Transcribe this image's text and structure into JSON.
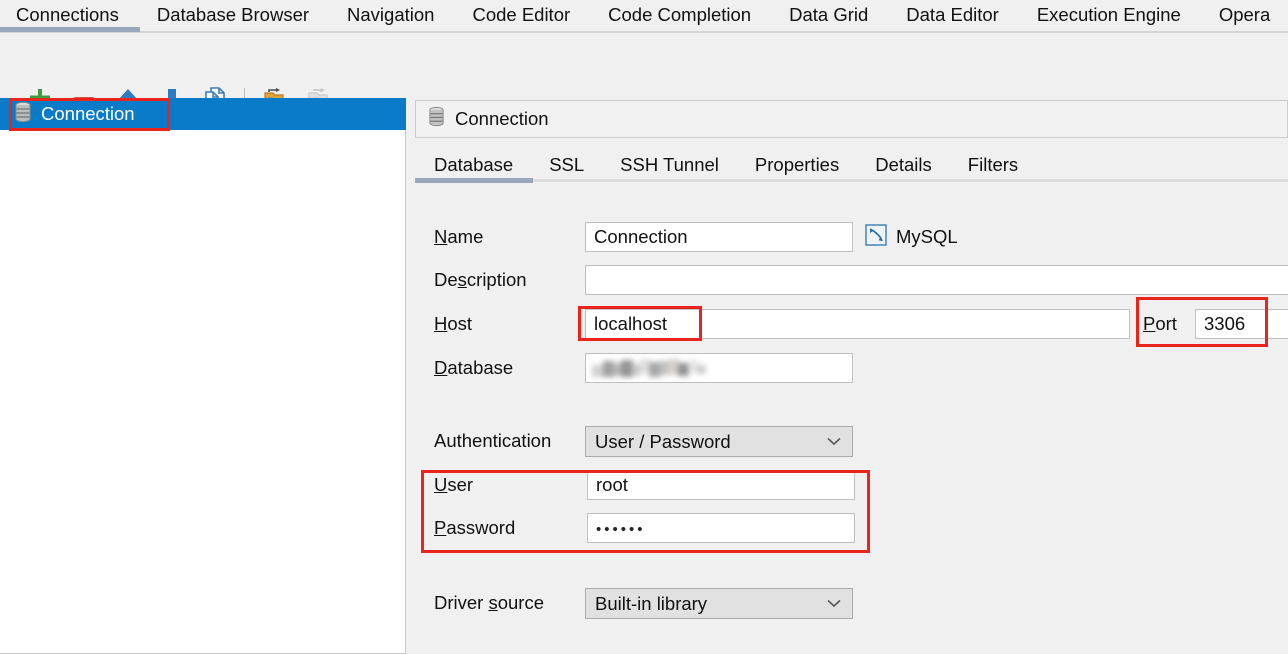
{
  "top_tabs": {
    "items": [
      {
        "label": "Connections",
        "active": true
      },
      {
        "label": "Database Browser",
        "active": false
      },
      {
        "label": "Navigation",
        "active": false
      },
      {
        "label": "Code Editor",
        "active": false
      },
      {
        "label": "Code Completion",
        "active": false
      },
      {
        "label": "Data Grid",
        "active": false
      },
      {
        "label": "Data Editor",
        "active": false
      },
      {
        "label": "Execution Engine",
        "active": false
      },
      {
        "label": "Opera",
        "active": false
      }
    ]
  },
  "toolbar": {
    "items": [
      {
        "name": "add-connection-button",
        "icon": "plus-icon",
        "enabled": true
      },
      {
        "name": "remove-connection-button",
        "icon": "minus-icon",
        "enabled": true
      },
      {
        "name": "move-up-button",
        "icon": "arrow-up-icon",
        "enabled": true
      },
      {
        "name": "move-down-button",
        "icon": "arrow-down-icon",
        "enabled": true
      },
      {
        "name": "duplicate-connection-button",
        "icon": "copy-documents-icon",
        "enabled": true
      },
      {
        "name": "import-connections-button",
        "icon": "import-database-icon",
        "enabled": true
      },
      {
        "name": "export-connections-button",
        "icon": "export-database-icon",
        "enabled": false
      }
    ]
  },
  "sidebar": {
    "items": [
      {
        "label": "Connection",
        "icon": "database-icon",
        "selected": true
      }
    ]
  },
  "panel": {
    "header": {
      "title": "Connection",
      "icon": "database-icon"
    },
    "tabs": [
      {
        "label": "Database",
        "active": true
      },
      {
        "label": "SSL",
        "active": false
      },
      {
        "label": "SSH Tunnel",
        "active": false
      },
      {
        "label": "Properties",
        "active": false
      },
      {
        "label": "Details",
        "active": false
      },
      {
        "label": "Filters",
        "active": false
      }
    ],
    "form": {
      "name": {
        "label": "Name",
        "mnemonic": "N",
        "value": "Connection",
        "placeholder": ""
      },
      "driver_badge": {
        "label": "MySQL",
        "icon": "mysql-dolphin-icon"
      },
      "description": {
        "label": "Description",
        "mnemonic": "s",
        "value": "",
        "placeholder": ""
      },
      "host": {
        "label": "Host",
        "mnemonic": "H",
        "value": "localhost",
        "placeholder": ""
      },
      "port": {
        "label": "Port",
        "mnemonic": "P",
        "value": "3306",
        "placeholder": ""
      },
      "database": {
        "label": "Database",
        "mnemonic": "D",
        "value": "",
        "placeholder": "",
        "redacted": true
      },
      "authentication": {
        "label": "Authentication",
        "mnemonic": "",
        "value": "User / Password",
        "options": [
          "User / Password"
        ]
      },
      "user": {
        "label": "User",
        "mnemonic": "U",
        "value": "root",
        "placeholder": ""
      },
      "password": {
        "label": "Password",
        "mnemonic": "P",
        "value": "••••••",
        "placeholder": ""
      },
      "driver_source": {
        "label": "Driver source",
        "mnemonic": "s",
        "value": "Built-in library",
        "options": [
          "Built-in library"
        ]
      }
    }
  },
  "annotations": {
    "color": "#e8241c",
    "boxes": [
      {
        "name": "annotation-connection-item"
      },
      {
        "name": "annotation-host-value"
      },
      {
        "name": "annotation-port-field"
      },
      {
        "name": "annotation-credentials"
      }
    ]
  },
  "colors": {
    "selection_blue": "#0a7bc8",
    "tab_underline": "#9aa7bb",
    "annotation_red": "#e8241c",
    "window_bg": "#f0f0f0",
    "field_bg": "#ffffff",
    "combo_bg": "#e1e1e1"
  }
}
